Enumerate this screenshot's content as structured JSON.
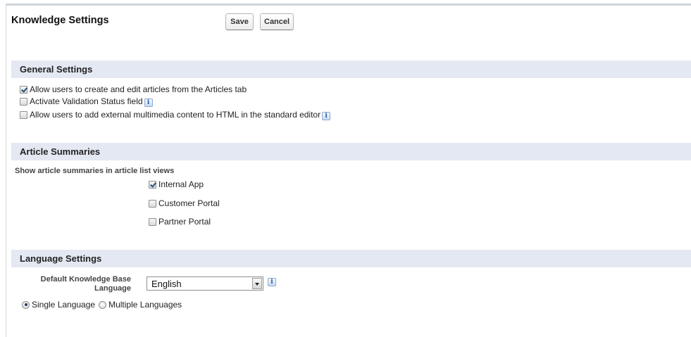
{
  "header": {
    "title": "Knowledge Settings",
    "save_label": "Save",
    "cancel_label": "Cancel"
  },
  "general": {
    "title": "General Settings",
    "options": [
      {
        "label": "Allow users to create and edit articles from the Articles tab",
        "checked": true,
        "info": false
      },
      {
        "label": "Activate Validation Status field",
        "checked": false,
        "info": true
      },
      {
        "label": "Allow users to add external multimedia content to HTML in the standard editor",
        "checked": false,
        "info": true
      }
    ]
  },
  "summaries": {
    "title": "Article Summaries",
    "subtitle": "Show article summaries in article list views",
    "options": [
      {
        "label": "Internal App",
        "checked": true
      },
      {
        "label": "Customer Portal",
        "checked": false
      },
      {
        "label": "Partner Portal",
        "checked": false
      }
    ]
  },
  "language": {
    "title": "Language Settings",
    "default_label": "Default Knowledge Base Language",
    "selected": "English",
    "radios": [
      {
        "label": "Single Language",
        "selected": true
      },
      {
        "label": "Multiple Languages",
        "selected": false
      }
    ]
  },
  "icons": {
    "info": "i"
  }
}
